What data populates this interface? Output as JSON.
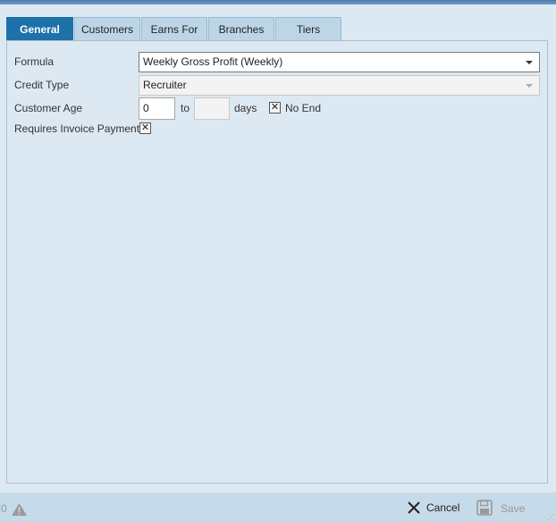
{
  "tabs": [
    {
      "label": "General",
      "active": true
    },
    {
      "label": "Customers",
      "active": false
    },
    {
      "label": "Earns For",
      "active": false
    },
    {
      "label": "Branches",
      "active": false
    },
    {
      "label": "Tiers",
      "active": false
    }
  ],
  "form": {
    "formula_label": "Formula",
    "formula_value": "Weekly Gross Profit (Weekly)",
    "credit_type_label": "Credit Type",
    "credit_type_value": "Recruiter",
    "customer_age_label": "Customer Age",
    "customer_age_from": "0",
    "to_label": "to",
    "customer_age_to": "",
    "days_label": "days",
    "no_end_label": "No End",
    "no_end_checked": true,
    "requires_invoice_label": "Requires Invoice Payment",
    "requires_invoice_checked": true
  },
  "footer": {
    "count": "0",
    "warning_icon": "warning-icon",
    "cancel_label": "Cancel",
    "save_label": "Save"
  }
}
